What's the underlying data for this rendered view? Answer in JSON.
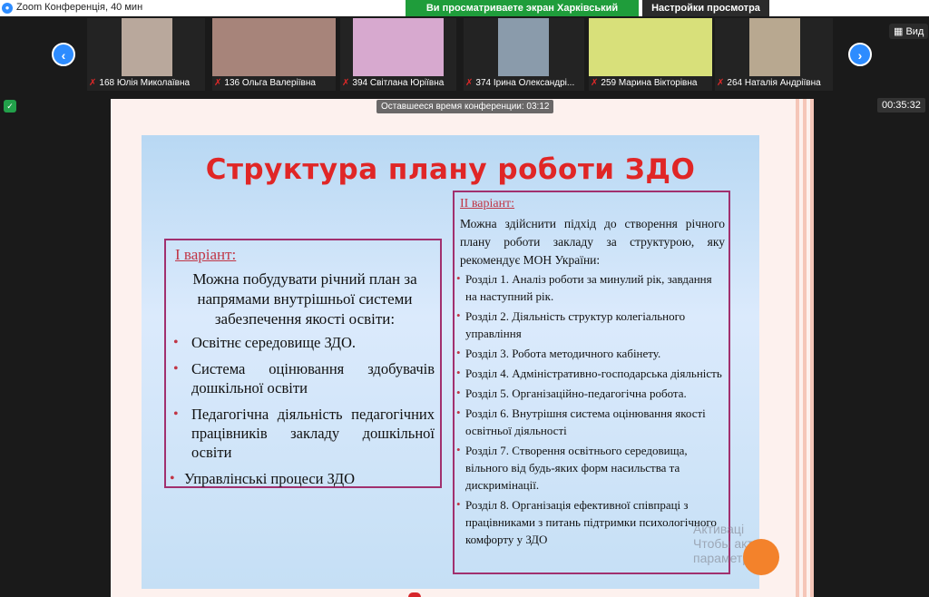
{
  "window": {
    "title": "Zoom Конференція, 40 мин"
  },
  "share_bar": {
    "viewing_text": "Ви просматриваете экран Харківський ЦПР",
    "view_options": "Настройки просмотра ⌄"
  },
  "gallery": {
    "view_button": "Вид",
    "participants": [
      {
        "name": "168 Юлія Миколаївна",
        "color": "#b9a89c"
      },
      {
        "name": "136 Ольга Валеріївна",
        "color": "#a7847a"
      },
      {
        "name": "394 Світлана Юріївна",
        "color": "#d7a9cf"
      },
      {
        "name": "374 Ірина Олександрі...",
        "color": "#8a9bab"
      },
      {
        "name": "259 Марина Вікторівна",
        "color": "#d8e07a"
      },
      {
        "name": "264 Наталія Андріївна",
        "color": "#b8a890"
      }
    ]
  },
  "stage": {
    "remaining_time": "Оставшееся время конференции: 03:12",
    "elapsed": "00:35:32"
  },
  "slide": {
    "title": "Структура плану роботи ЗДО",
    "variant1": {
      "heading": "І варіант:",
      "intro": "Можна побудувати річний план за напрямами внутрішньої системи забезпечення якості освіти:",
      "items": [
        "Освітнє середовище ЗДО.",
        "Система оцінювання здобувачів дошкільної освіти",
        "Педагогічна діяльність педагогічних працівників закладу дошкільної освіти",
        "Управлінські процеси ЗДО"
      ]
    },
    "variant2": {
      "heading": "ІІ варіант:",
      "intro": "Можна здійснити підхід до створення річного плану роботи закладу за структурою, яку рекомендує МОН України:",
      "items": [
        "Розділ 1. Аналіз роботи за минулий рік, завдання на наступний рік.",
        "Розділ 2. Діяльність структур колегіального управління",
        "Розділ 3. Робота методичного кабінету.",
        "Розділ 4. Адміністративно-господарська діяльність",
        "Розділ 5. Організаційно-педагогічна робота.",
        "Розділ 6. Внутрішня система оцінювання якості освітньої діяльності",
        "Розділ 7. Створення освітнього середовища, вільного від будь-яких форм насильства та дискримінації.",
        "Розділ 8. Організація ефективної співпраці з працівниками з питань підтримки психологічного комфорту у ЗДО"
      ]
    },
    "watermark_line1": "Активаці",
    "watermark_line2": "Чтобы акти",
    "watermark_line3": "параметра"
  }
}
